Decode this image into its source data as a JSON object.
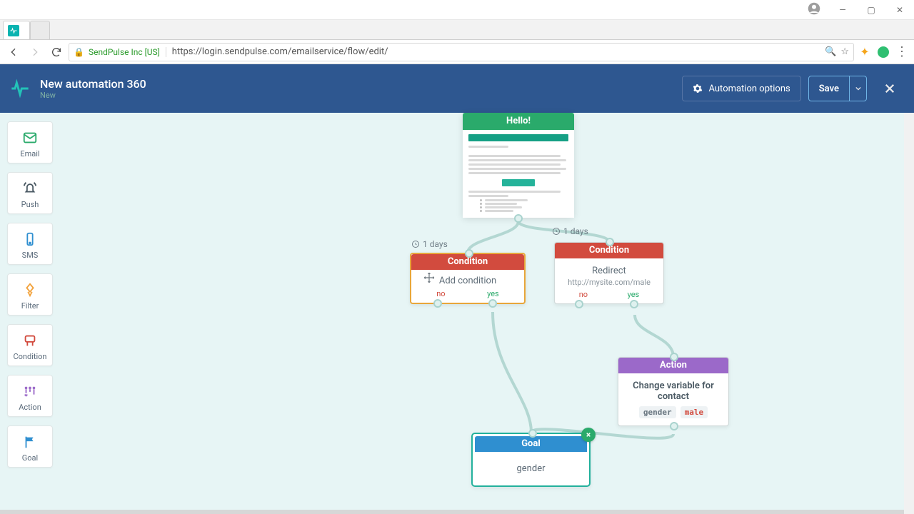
{
  "browser": {
    "security_label": "SendPulse Inc [US]",
    "url": "https://login.sendpulse.com/emailservice/flow/edit/"
  },
  "header": {
    "title": "New automation 360",
    "subtitle": "New",
    "options_label": "Automation options",
    "save_label": "Save"
  },
  "palette": {
    "email": "Email",
    "push": "Push",
    "sms": "SMS",
    "filter": "Filter",
    "condition": "Condition",
    "action": "Action",
    "goal": "Goal"
  },
  "nodes": {
    "hello": {
      "title": "Hello!"
    },
    "cond1": {
      "title": "Condition",
      "body": "Add condition",
      "no": "no",
      "yes": "yes",
      "delay": "1 days"
    },
    "cond2": {
      "title": "Condition",
      "body": "Redirect",
      "sub": "http://mysite.com/male",
      "no": "no",
      "yes": "yes",
      "delay": "1 days"
    },
    "action": {
      "title": "Action",
      "body": "Change variable for contact",
      "var": "gender",
      "val": "male"
    },
    "goal": {
      "title": "Goal",
      "body": "gender"
    }
  }
}
